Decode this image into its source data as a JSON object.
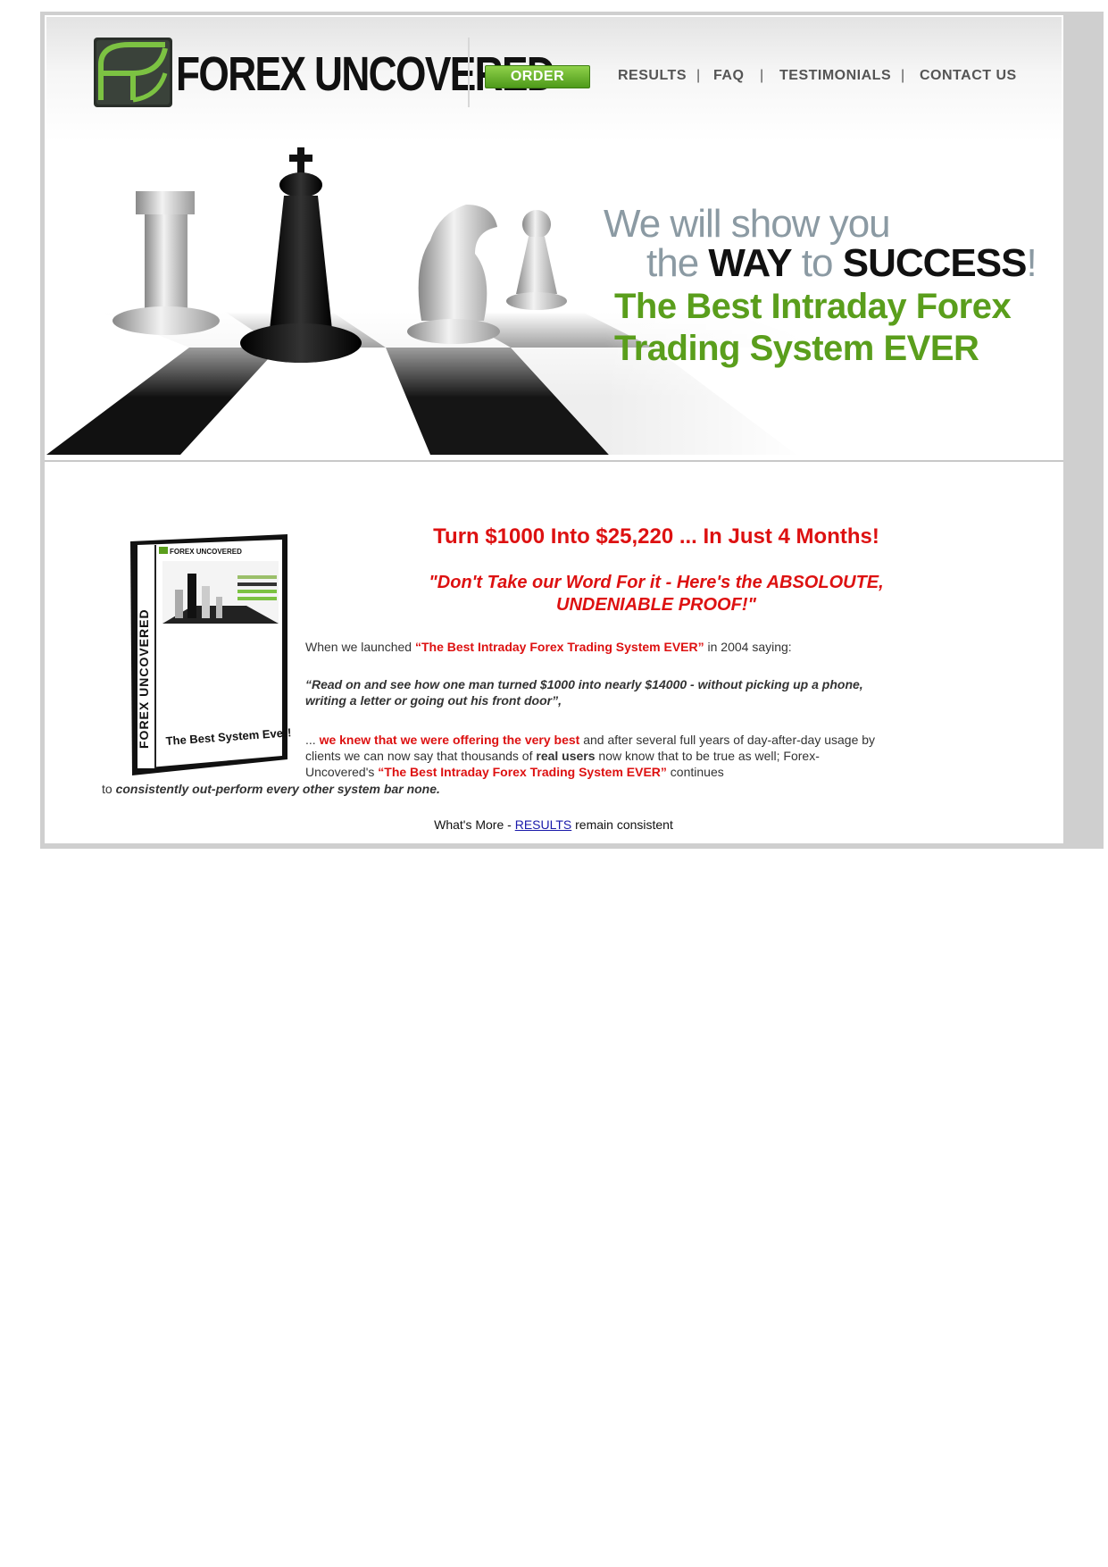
{
  "brand": {
    "name": "FOREX UNCOVERED",
    "accent_color": "#5a9e1c",
    "headline_color": "#dd1111",
    "logo_icon": "forex-uncovered-logo-icon"
  },
  "nav": {
    "order_label": "ORDER",
    "items": [
      "RESULTS",
      "FAQ",
      "TESTIMONIALS",
      "CONTACT US"
    ],
    "separator": "|"
  },
  "hero": {
    "line1": "We will show you",
    "line2_pre": "the ",
    "line2_way": "WAY",
    "line2_to": " to ",
    "line2_success": "SUCCESS",
    "line2_end": "!",
    "line3": "The Best Intraday Forex",
    "line4": "Trading System EVER",
    "image": "chess-pieces-image"
  },
  "product": {
    "spine_text": "FOREX UNCOVERED",
    "top_label": "FOREX UNCOVERED",
    "bottom_label": "The Best System Ever!"
  },
  "content": {
    "title": "Turn $1000 Into $25,220 ... In Just 4 Months!",
    "proof_line1": "\"Don't Take our Word For it - Here's the ABSOLOUTE,",
    "proof_line2": "UNDENIABLE PROOF!\"",
    "launch_pre": "When we launched ",
    "launch_product": "“The Best Intraday Forex Trading System EVER”",
    "launch_post": " in 2004 saying:",
    "quote": "“Read on and see how one man turned $1000 into nearly $14000 - without picking up a phone, writing a letter or going out his front door”,",
    "para_pre": "... ",
    "para_red": "we knew that we were offering the very best",
    "para_mid": " and after several full years of day-after-day usage by clients we can now say that thousands of ",
    "para_bold": "real users",
    "para_mid2": " now know that to be true as well; Forex-Uncovered's ",
    "para_product": "“The Best Intraday Forex Trading System EVER”",
    "para_end": " continues",
    "last_pre": "to ",
    "last_bold": "consistently out-perform every other system bar none.",
    "results_pre": "What's More - ",
    "results_link": "RESULTS",
    "results_post": " remain consistent"
  }
}
